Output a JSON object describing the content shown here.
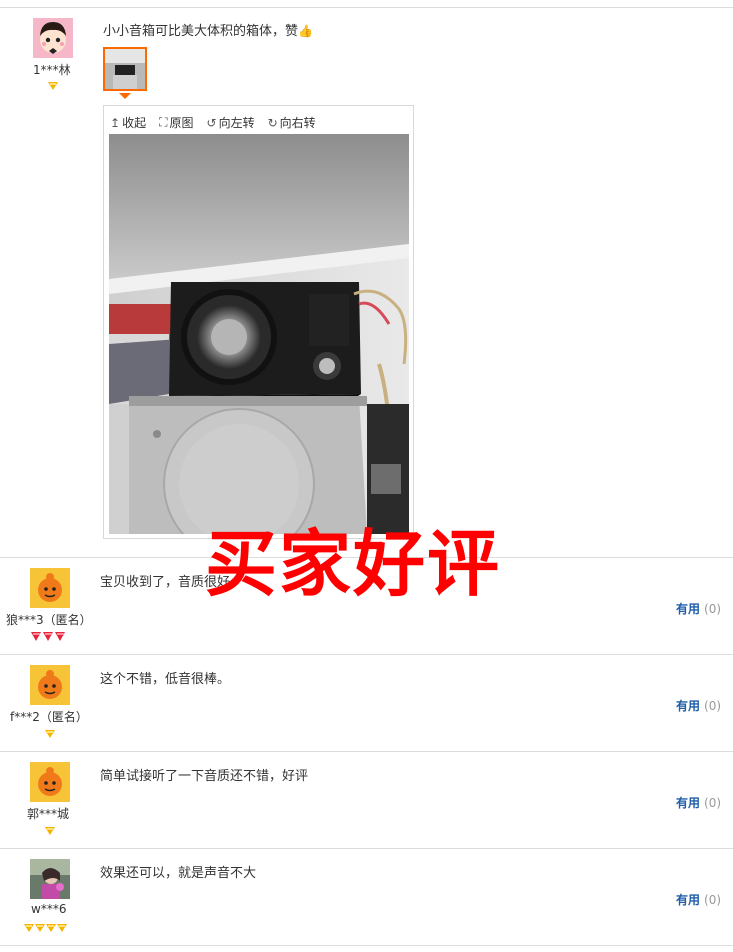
{
  "reviews": [
    {
      "user": "1***林",
      "avatar": "cartoon-avatar",
      "level_icons": [
        "yellow-diamond"
      ],
      "text": "小小音箱可比美大体积的箱体，赞",
      "emoji": "thumbs-up-icon",
      "has_photo": true
    },
    {
      "user": "狼***3（匿名）",
      "avatar": "default-orange-avatar",
      "level_icons": [
        "red-diamond",
        "red-diamond",
        "red-diamond"
      ],
      "text": "宝贝收到了，音质很好。",
      "useful_label": "有用",
      "useful_count": "(0)"
    },
    {
      "user": "f***2（匿名）",
      "avatar": "default-orange-avatar",
      "level_icons": [
        "yellow-diamond"
      ],
      "text": "这个不错，低音很棒。",
      "useful_label": "有用",
      "useful_count": "(0)"
    },
    {
      "user": "郭***城",
      "avatar": "default-orange-avatar",
      "level_icons": [
        "yellow-diamond"
      ],
      "text": "简单试接听了一下音质还不错，好评",
      "useful_label": "有用",
      "useful_count": "(0)"
    },
    {
      "user": "w***6",
      "avatar": "photo-avatar",
      "level_icons": [
        "yellow-diamond",
        "yellow-diamond",
        "yellow-diamond",
        "yellow-diamond"
      ],
      "text": "效果还可以，就是声音不大",
      "useful_label": "有用",
      "useful_count": "(0)"
    }
  ],
  "viewer": {
    "collapse": "收起",
    "original": "原图",
    "rotate_left": "向左转",
    "rotate_right": "向右转"
  },
  "watermark": "买家好评",
  "colors": {
    "accent_orange": "#ff6a00",
    "link_blue": "#1f5ea8",
    "watermark_red": "#ff0000",
    "divider": "#dcdcdc"
  }
}
